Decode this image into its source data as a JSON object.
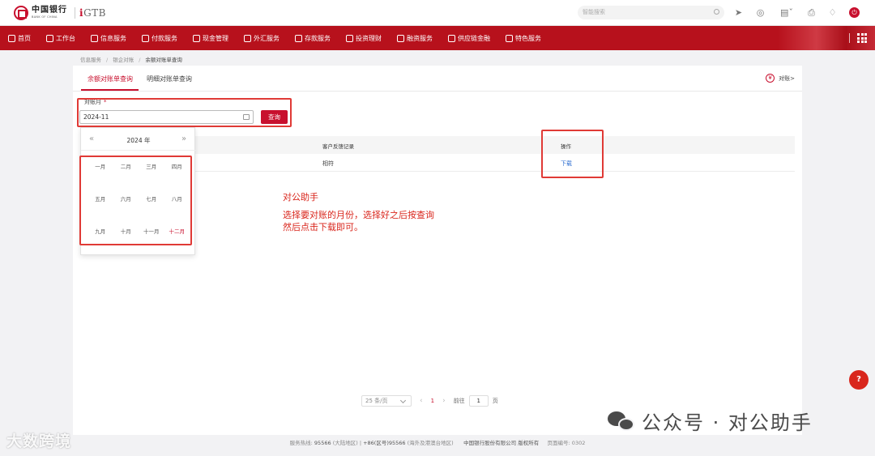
{
  "header": {
    "bank_name_cn": "中国银行",
    "bank_name_en": "BANK OF CHINA",
    "product": "GTB",
    "search_placeholder": "智能搜索"
  },
  "nav": {
    "items": [
      {
        "label": "首页",
        "icon": "home-icon"
      },
      {
        "label": "工作台",
        "icon": "desk-icon"
      },
      {
        "label": "信息服务",
        "icon": "info-icon"
      },
      {
        "label": "付款服务",
        "icon": "payment-icon"
      },
      {
        "label": "现金管理",
        "icon": "cash-icon"
      },
      {
        "label": "外汇服务",
        "icon": "fx-icon"
      },
      {
        "label": "存款服务",
        "icon": "deposit-icon"
      },
      {
        "label": "投资理财",
        "icon": "invest-icon"
      },
      {
        "label": "融资服务",
        "icon": "financing-icon"
      },
      {
        "label": "供应链金融",
        "icon": "supply-chain-icon"
      },
      {
        "label": "特色服务",
        "icon": "special-icon"
      }
    ]
  },
  "breadcrumb": [
    "信息服务",
    "银企对账",
    "余额对账单查询"
  ],
  "tabs": [
    "余额对账单查询",
    "明细对账单查询"
  ],
  "recon_link": "对账>",
  "form": {
    "month_label": "对账月",
    "required_mark": "*",
    "month_value": "2024-11",
    "query_button": "查询"
  },
  "table": {
    "headers": [
      "客户反馈记录",
      "操作"
    ],
    "rows": [
      {
        "feedback": "相符",
        "action": "下载"
      }
    ]
  },
  "picker": {
    "prev": "«",
    "next": "»",
    "year": "2024 年",
    "months": [
      "一月",
      "二月",
      "三月",
      "四月",
      "五月",
      "六月",
      "七月",
      "八月",
      "九月",
      "十月",
      "十一月",
      "十二月"
    ],
    "selected_index": 11
  },
  "annotation": {
    "title": "对公助手",
    "line1": "选择要对账的月份，选择好之后按查询",
    "line2": "然后点击下载即可。"
  },
  "pager": {
    "page_size": "25 条/页",
    "current_page": "1",
    "goto_label": "前往",
    "goto_value": "1",
    "page_suffix": "页"
  },
  "footer": {
    "hotline_label": "服务热线:",
    "hotline_mainland": "95566",
    "mainland_note": "(大陆地区)",
    "hotline_intl": "+86(区号)95566",
    "intl_note": "(海外及港澳台地区)",
    "company": "中国银行股份有限公司 版权所有",
    "page_code": "页面编号: 0302"
  },
  "watermarks": {
    "left": "大数跨境",
    "right": "公众号 · 对公助手"
  },
  "help": "?",
  "colors": {
    "brand_red": "#b7111c",
    "accent_red": "#c8102e",
    "link_blue": "#2f6fd1"
  }
}
